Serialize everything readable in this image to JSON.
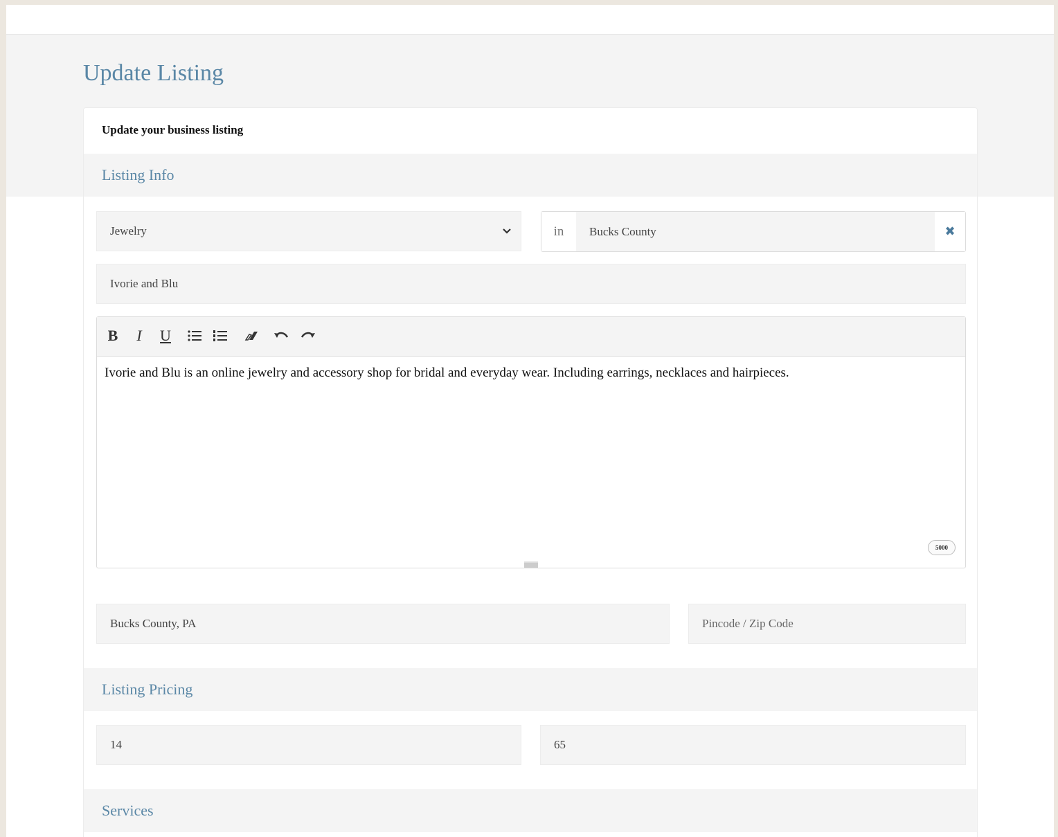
{
  "page": {
    "title": "Update Listing"
  },
  "card": {
    "subtitle": "Update your business listing"
  },
  "sections": {
    "listing_info": "Listing Info",
    "listing_pricing": "Listing Pricing",
    "services": "Services"
  },
  "listing_info": {
    "category_value": "Jewelry",
    "location_prefix": "in",
    "location_value": "Bucks County",
    "business_name": "Ivorie and Blu",
    "description": "Ivorie and Blu is an online jewelry and accessory shop for bridal and everyday wear. Including earrings, necklaces and hairpieces.",
    "char_limit": "5000",
    "address_value": "Bucks County, PA",
    "zip_placeholder": "Pincode / Zip Code"
  },
  "toolbar": {
    "bold": "B",
    "italic": "I",
    "underline": "U",
    "icons": [
      "bullet-list-icon",
      "numbered-list-icon",
      "eraser-icon",
      "undo-icon",
      "redo-icon"
    ]
  },
  "pricing": {
    "min_value": "14",
    "max_value": "65"
  },
  "colors": {
    "accent": "#5a87a6",
    "field_bg": "#f4f4f4",
    "page_bg": "#ece7df"
  }
}
